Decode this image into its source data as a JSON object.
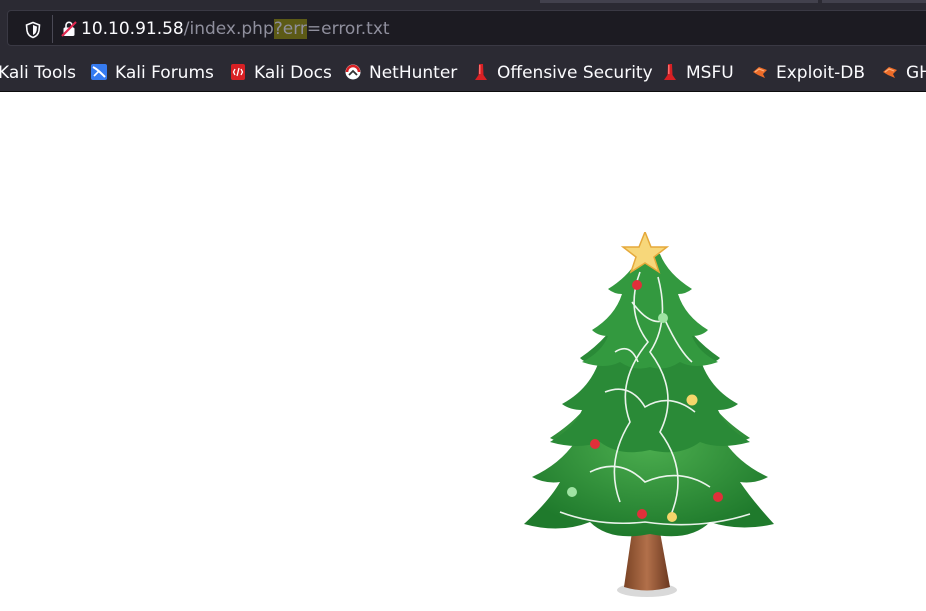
{
  "address_bar": {
    "host": "10.10.91.58",
    "path": "/index.php",
    "query_key": "?err",
    "query_rest": "=error.txt"
  },
  "bookmarks": [
    {
      "label": "Kali Tools",
      "icon": "kali-tools-icon"
    },
    {
      "label": "Kali Forums",
      "icon": "kali-forums-icon"
    },
    {
      "label": "Kali Docs",
      "icon": "kali-docs-icon"
    },
    {
      "label": "NetHunter",
      "icon": "nethunter-icon"
    },
    {
      "label": "Offensive Security",
      "icon": "offsec-icon"
    },
    {
      "label": "MSFU",
      "icon": "msfu-icon"
    },
    {
      "label": "Exploit-DB",
      "icon": "exploit-db-icon"
    },
    {
      "label": "GH",
      "icon": "ghdb-icon"
    }
  ],
  "page": {
    "image": "christmas-tree"
  },
  "colors": {
    "toolbar": "#2b2a33",
    "url_field": "#1c1b22",
    "query_highlight": "#5c5a16",
    "tree_green": "#2e8b3a"
  }
}
